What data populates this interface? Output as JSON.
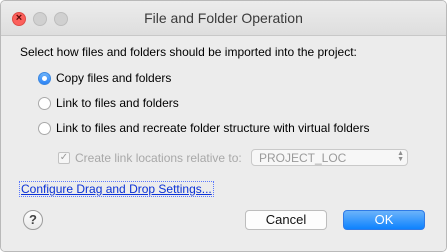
{
  "window": {
    "title": "File and Folder Operation",
    "close_symbol": "×"
  },
  "dialog": {
    "prompt": "Select how files and folders should be imported into the project:",
    "options": [
      {
        "label": "Copy files and folders",
        "selected": true
      },
      {
        "label": "Link to files and folders",
        "selected": false
      },
      {
        "label": "Link to files and recreate folder structure with virtual folders",
        "selected": false
      }
    ],
    "relative_checkbox": {
      "label": "Create link locations relative to:",
      "checked": true,
      "enabled": false,
      "check_glyph": "✓"
    },
    "location_select": {
      "value": "PROJECT_LOC",
      "arrow_up": "▲",
      "arrow_down": "▼"
    },
    "configure_link": "Configure Drag and Drop Settings...",
    "help_symbol": "?",
    "cancel_label": "Cancel",
    "ok_label": "OK"
  },
  "colors": {
    "accent": "#2b83f6",
    "link": "#0b31d6",
    "close_button": "#fc605c"
  },
  "icons": {
    "close": "close-icon",
    "help": "help-icon",
    "select_arrows": "chevron-up-down-icon"
  }
}
